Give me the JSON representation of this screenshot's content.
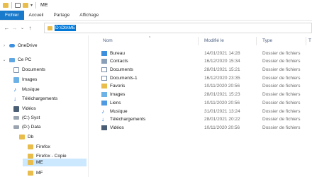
{
  "window": {
    "title": "ME"
  },
  "ribbon": {
    "tabs": [
      "Fichier",
      "Accueil",
      "Partage",
      "Affichage"
    ]
  },
  "address": {
    "path": "D:\\Db\\ME"
  },
  "columns": {
    "name": "Nom",
    "modified": "Modifié le",
    "type": "Type",
    "size": "T"
  },
  "nav": {
    "onedrive": "OneDrive",
    "this_pc": "Ce PC",
    "documents": "Documents",
    "images": "Images",
    "musique": "Musique",
    "telechargements": "Téléchargements",
    "videos": "Vidéos",
    "c_drive": "(C:) Syst",
    "d_drive": "(D:) Data",
    "db": "Db",
    "firefox": "Firefox",
    "firefox_copie": "Firefox - Copie",
    "me": "ME",
    "mf": "MF"
  },
  "files": [
    {
      "name": "Bureau",
      "modified": "14/01/2021 14:28",
      "type": "Dossier de fichiers",
      "icon": "desktop-folder-icon"
    },
    {
      "name": "Contacts",
      "modified": "16/12/2020 15:34",
      "type": "Dossier de fichiers",
      "icon": "contacts-folder-icon"
    },
    {
      "name": "Documents",
      "modified": "28/01/2021 15:21",
      "type": "Dossier de fichiers",
      "icon": "documents-folder-icon"
    },
    {
      "name": "Documents-1",
      "modified": "16/12/2020 23:35",
      "type": "Dossier de fichiers",
      "icon": "documents-folder-icon"
    },
    {
      "name": "Favoris",
      "modified": "10/11/2020 20:56",
      "type": "Dossier de fichiers",
      "icon": "favorites-folder-icon"
    },
    {
      "name": "Images",
      "modified": "28/01/2021 15:23",
      "type": "Dossier de fichiers",
      "icon": "pictures-folder-icon"
    },
    {
      "name": "Liens",
      "modified": "10/11/2020 20:56",
      "type": "Dossier de fichiers",
      "icon": "links-folder-icon"
    },
    {
      "name": "Musique",
      "modified": "31/01/2021 13:24",
      "type": "Dossier de fichiers",
      "icon": "music-folder-icon"
    },
    {
      "name": "Téléchargements",
      "modified": "28/01/2021 20:22",
      "type": "Dossier de fichiers",
      "icon": "downloads-folder-icon"
    },
    {
      "name": "Vidéos",
      "modified": "10/11/2020 20:56",
      "type": "Dossier de fichiers",
      "icon": "videos-folder-icon"
    }
  ],
  "colors": {
    "accent": "#1979ca",
    "selection": "#cce8ff",
    "folder": "#e9bd4c"
  }
}
